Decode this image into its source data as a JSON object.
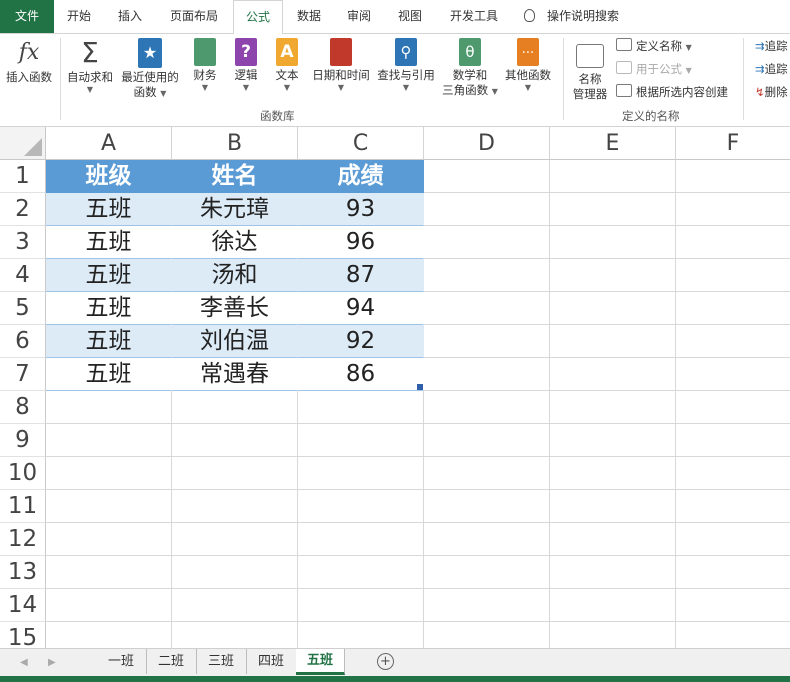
{
  "ribbon_tabs": [
    "文件",
    "开始",
    "插入",
    "页面布局",
    "公式",
    "数据",
    "审阅",
    "视图",
    "开发工具"
  ],
  "tell_me": "操作说明搜索",
  "formula_buttons": {
    "insert_function": "插入函数",
    "autosum": "自动求和",
    "recent_line1": "最近使用的",
    "recent_line2": "函数",
    "financial": "财务",
    "logical": "逻辑",
    "text": "文本",
    "datetime": "日期和时间",
    "lookup": "查找与引用",
    "math_line1": "数学和",
    "math_line2": "三角函数",
    "more": "其他函数",
    "fx_symbol": "fx",
    "sigma_symbol": "Σ",
    "theta_symbol": "θ",
    "question_symbol": "?",
    "a_symbol": "A",
    "dots_symbol": "..."
  },
  "group_function_library": "函数库",
  "defined_names": {
    "name_manager_line1": "名称",
    "name_manager_line2": "管理器",
    "define_name": "定义名称",
    "use_in_formula": "用于公式",
    "create_from_selection": "根据所选内容创建",
    "group_label": "定义的名称"
  },
  "audit_cmds": [
    "追踪",
    "追踪",
    "删除"
  ],
  "columns": [
    "A",
    "B",
    "C",
    "D",
    "E",
    "F"
  ],
  "rows": [
    "1",
    "2",
    "3",
    "4",
    "5",
    "6",
    "7",
    "8",
    "9",
    "10",
    "11",
    "12",
    "13",
    "14",
    "15"
  ],
  "table": {
    "headers": [
      "班级",
      "姓名",
      "成绩"
    ],
    "rows": [
      [
        "五班",
        "朱元璋",
        "93"
      ],
      [
        "五班",
        "徐达",
        "96"
      ],
      [
        "五班",
        "汤和",
        "87"
      ],
      [
        "五班",
        "李善长",
        "94"
      ],
      [
        "五班",
        "刘伯温",
        "92"
      ],
      [
        "五班",
        "常遇春",
        "86"
      ]
    ]
  },
  "sheets": [
    "一班",
    "二班",
    "三班",
    "四班",
    "五班"
  ],
  "active_sheet": "五班",
  "colors": {
    "excel_green": "#217346",
    "table_header": "#5b9bd5",
    "band": "#ddebf7"
  }
}
